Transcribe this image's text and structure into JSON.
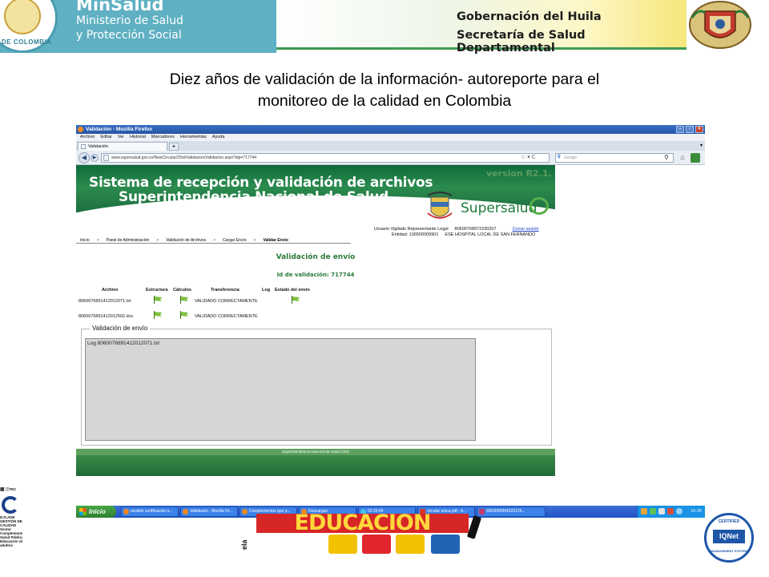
{
  "header": {
    "ministry_title": "MinSalud",
    "ministry_line1": "Ministerio de Salud",
    "ministry_line2": "y Protección Social",
    "ministry_seal_text": "DE COLOMBIA",
    "gov_title": "Gobernación del Huila",
    "gov_subtitle": "Secretaría de Salud Departamental"
  },
  "slide": {
    "title_line1": "Diez años de validación de la información- autoreporte para el",
    "title_line2": "monitoreo de la calidad en Colombia"
  },
  "browser": {
    "window_title": "Validación - Mozilla Firefox",
    "menu": [
      "Archivo",
      "Editar",
      "Ver",
      "Historial",
      "Marcadores",
      "Herramientas",
      "Ayuda"
    ],
    "tab_label": "Validación",
    "new_tab_label": "+",
    "url": "www.supersalud.gov.co/NewCircular/25nt/Validacion/Validacion.aspx?idp=717744",
    "search_placeholder": "Google",
    "search_engine_glyph": "g"
  },
  "page": {
    "banner_title_line1": "Sistema de recepción y validación de archivos",
    "banner_title_line2": "Superintendencia Nacional de Salud",
    "version": "version R2.1.",
    "brand": "Supersalud",
    "user_label": "Usuario Vigilado Representante Legal",
    "user_id": "80600768972230207",
    "logout_label": "Cerrar sesión",
    "entity_label": "Entidad: 136500009901",
    "entity_name": "ESE HOSPITAL LOCAL DE SAN FERNANDO",
    "breadcrumb": [
      "Inicio",
      "Panel de Administración",
      "Validación de Archivos",
      "Cargar Envío",
      "Validar Envío"
    ],
    "breadcrumb_sep": ">",
    "validation_title": "Validación de envío",
    "validation_id": "Id de validación: 717744",
    "table_headers": [
      "Archivo",
      "Estructura",
      "Cálculos",
      "Transferencia",
      "Log",
      "Estado del envío"
    ],
    "files": [
      {
        "name": "8060076891412012071.txt",
        "status": "VALIDADO CORRECTAMENTE"
      },
      {
        "name": "8060076891412012502.doc",
        "status": "VALIDADO CORRECTAMENTE"
      }
    ],
    "fieldset_legend": "Validación de envío",
    "log_text": "Log 8060076891412012071.txt",
    "footer_text": "Superintendencia Nacional de Salud 2010"
  },
  "taskbar": {
    "start_label": "Inicio",
    "items": [
      "modelo certificación e...",
      "Validación - Mozilla Fir...",
      "Complementos que p...",
      "Descargas",
      "02:20:49",
      "circular unica.pdf - A...",
      "9003094994320125..."
    ],
    "clock": "10:35"
  },
  "footer_logos": {
    "icontec_lines": [
      "⬛ ⓘTEC",
      "",
      "",
      "D.D.ADE",
      "GESTIÓN DE",
      "CALIDAD",
      "",
      "Sector",
      "Complemento",
      "Salud Pública",
      "Educación de",
      "adultos"
    ],
    "edu_side": "ela",
    "edu_word": "EDUCACIÓN",
    "iqnet_top": "CERTIFIED",
    "iqnet_main": "IQNet",
    "iqnet_bottom": "MANAGEMENT SYSTEM"
  },
  "colors": {
    "ministry_teal": "#5fb0c2",
    "supersalud_green": "#2b8b4e",
    "validation_green": "#2b7a3a",
    "flag_green": "#7fc241",
    "taskbar_blue": "#2253c4",
    "education_red": "#d72626"
  }
}
